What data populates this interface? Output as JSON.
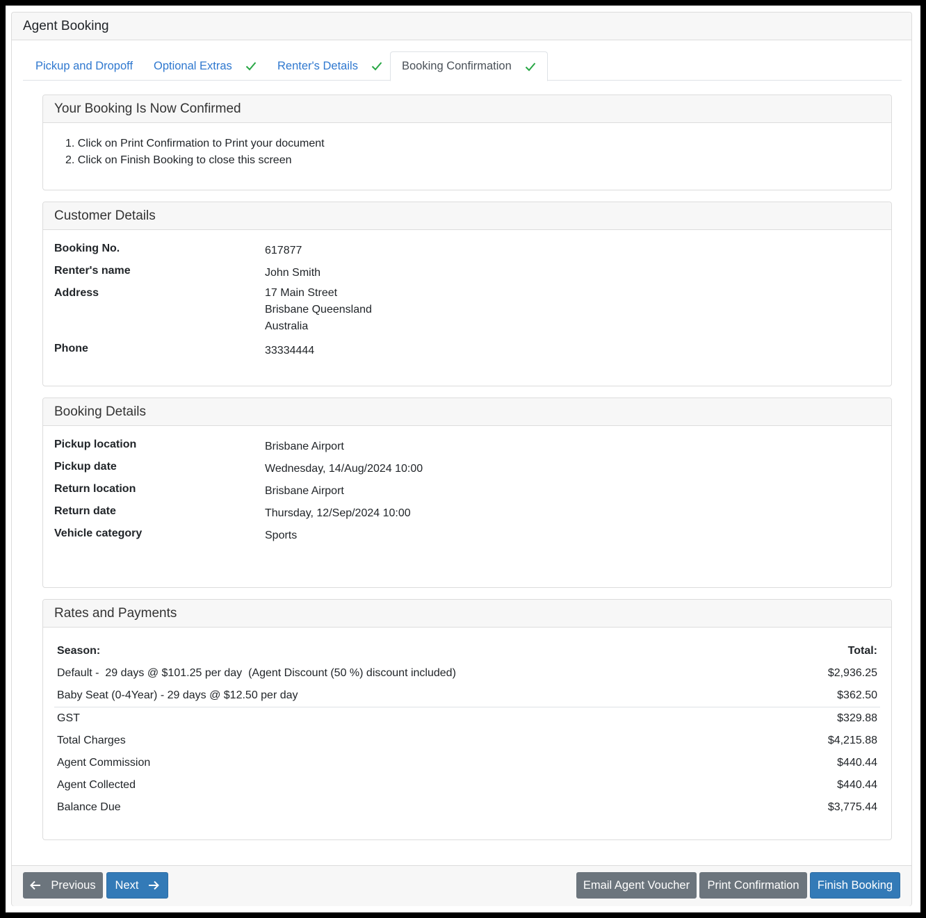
{
  "title": "Agent Booking",
  "tabs": [
    {
      "label": "Pickup and Dropoff",
      "checked": false
    },
    {
      "label": "Optional Extras",
      "checked": true
    },
    {
      "label": "Renter's Details",
      "checked": true
    },
    {
      "label": "Booking Confirmation",
      "checked": true,
      "active": true
    }
  ],
  "confirm": {
    "title": "Your Booking Is Now Confirmed",
    "steps": [
      "Click on Print Confirmation to Print your document",
      "Click on Finish Booking to close this screen"
    ]
  },
  "customer": {
    "title": "Customer Details",
    "booking_no_label": "Booking No.",
    "booking_no": "617877",
    "renter_label": "Renter's name",
    "renter": "John Smith",
    "address_label": "Address",
    "address": [
      "17 Main Street",
      "Brisbane Queensland",
      "Australia"
    ],
    "phone_label": "Phone",
    "phone": "33334444"
  },
  "booking": {
    "title": "Booking Details",
    "pickup_location_label": "Pickup location",
    "pickup_location": "Brisbane Airport",
    "pickup_date_label": "Pickup date",
    "pickup_date": "Wednesday, 14/Aug/2024 10:00",
    "return_location_label": "Return location",
    "return_location": "Brisbane Airport",
    "return_date_label": "Return date",
    "return_date": "Thursday, 12/Sep/2024 10:00",
    "vehicle_label": "Vehicle category",
    "vehicle": "Sports"
  },
  "rates": {
    "title": "Rates and Payments",
    "season_label": "Season:",
    "total_label": "Total:",
    "lines": [
      {
        "desc": "Default -  29 days @ $101.25 per day  (Agent Discount (50 %) discount included)",
        "amount": "$2,936.25"
      },
      {
        "desc": "Baby Seat (0-4Year) - 29 days @ $12.50 per day",
        "amount": "$362.50"
      }
    ],
    "summary": [
      {
        "desc": "GST",
        "amount": "$329.88"
      },
      {
        "desc": "Total Charges",
        "amount": "$4,215.88"
      },
      {
        "desc": "Agent Commission",
        "amount": "$440.44"
      },
      {
        "desc": "Agent Collected",
        "amount": "$440.44"
      },
      {
        "desc": "Balance Due",
        "amount": "$3,775.44"
      }
    ]
  },
  "footer": {
    "previous": "Previous",
    "next": "Next",
    "email": "Email Agent Voucher",
    "print": "Print Confirmation",
    "finish": "Finish Booking"
  },
  "colors": {
    "link": "#2f78cf",
    "check": "#28a745",
    "primary": "#337ab7",
    "secondary": "#6c757d"
  }
}
